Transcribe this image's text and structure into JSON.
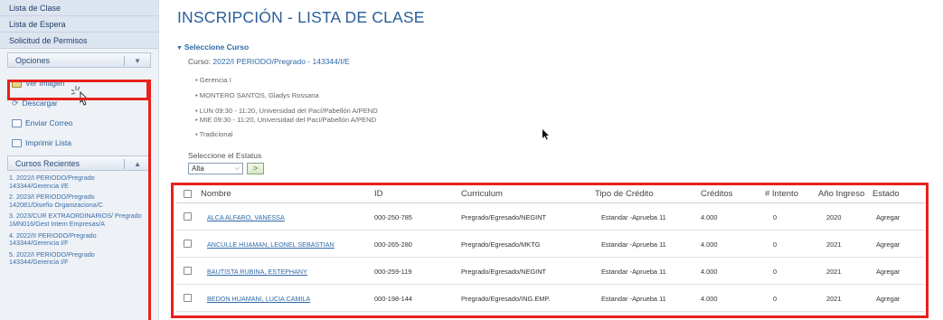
{
  "sidebar": {
    "nav": [
      "Lista de Clase",
      "Lista de Espera",
      "Solicitud de Permisos"
    ],
    "options_header": "Opciones",
    "actions": [
      {
        "label": "Ver Imagen",
        "icon": "image-icon"
      },
      {
        "label": "Descargar",
        "icon": "refresh-icon"
      },
      {
        "label": "Enviar Correo",
        "icon": "mail-icon"
      },
      {
        "label": "Imprimir Lista",
        "icon": "print-icon"
      }
    ],
    "recent_header": "Cursos Recientes",
    "recent": [
      "1. 2022/I PERIODO/Pregrado\n143344/Gerencia I/E",
      "2. 2023/I PERIODO/Pregrado\n142081/Diseño Organizaciona/C",
      "3. 2023/CUR EXTRAORDINARIOS/ Pregrado\n1MN016/Gest Intern Empresas/A",
      "4. 2022/II PERIODO/Pregrado\n143344/Gerencia I/F",
      "5. 2022/I PERIODO/Pregrado\n143344/Gerencia I/F"
    ]
  },
  "main": {
    "title": "INSCRIPCIÓN - LISTA DE CLASE",
    "select_course_label": "Seleccione Curso",
    "course_label": "Curso:",
    "course_value": "2022/I PERIODO/Pregrado - 143344/I/E",
    "course_name": "Gerencia I",
    "instructor": "MONTERO SANTOS, Gladys Rossana",
    "schedule_1": "LUN 09:30 - 11:20, Universidad del Pací/Pabellón A/PEND",
    "schedule_2": "MIE 09:30 - 11:20, Universidad del Pací/Pabellón A/PEND",
    "modality": "Tradicional",
    "status_label": "Seleccione el Estatus",
    "status_value": "Alta",
    "go_label": ">"
  },
  "table": {
    "headers": [
      "Nombre",
      "ID",
      "Curriculum",
      "Tipo de Crédito",
      "Créditos",
      "# Intento",
      "Año Ingreso",
      "Estado"
    ],
    "rows": [
      [
        "ALCA ALFARO, VANESSA",
        "000-250-785",
        "Pregrado/Egresado/NEGINT",
        "Estandar -Aprueba 11",
        "4.000",
        "0",
        "2020",
        "Agregar"
      ],
      [
        "ANCULLE HUAMAN, LEONEL SEBASTIAN",
        "000-265-280",
        "Pregrado/Egresado/MKTG",
        "Estandar -Aprueba 11",
        "4.000",
        "0",
        "2021",
        "Agregar"
      ],
      [
        "BAUTISTA RUBINA, ESTEPHANY",
        "000-259-119",
        "Pregrado/Egresado/NEGINT",
        "Estandar -Aprueba 11",
        "4.000",
        "0",
        "2021",
        "Agregar"
      ],
      [
        "BEDON HUAMANI, LUCIA CAMILA",
        "000-198-144",
        "Pregrado/Egresado/ING.EMP.",
        "Estandar -Aprueba 11",
        "4.000",
        "0",
        "2021",
        "Agregar"
      ]
    ]
  },
  "colors": {
    "highlight": "#e8201b",
    "title": "#2b5e99",
    "link": "#2f6aa8"
  }
}
